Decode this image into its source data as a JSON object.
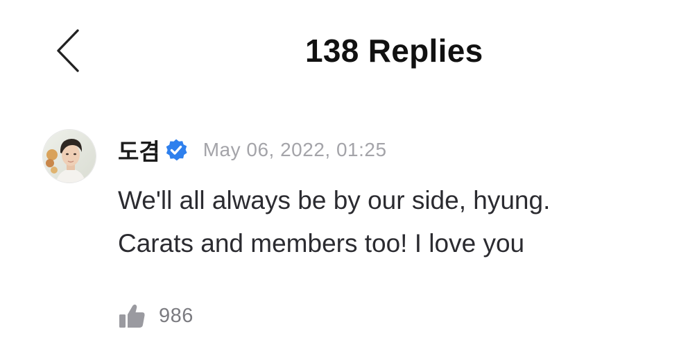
{
  "header": {
    "back_icon": "chevron-left-icon",
    "title": "138 Replies"
  },
  "comment": {
    "avatar_icon": "user-photo-avatar",
    "username": "도겸",
    "verified_icon": "verified-badge-icon",
    "timestamp": "May 06, 2022, 01:25",
    "body_lines": [
      "We'll all always be by our side, hyung.",
      "Carats and members too! I love you"
    ],
    "like_icon": "thumbs-up-icon",
    "like_count": "986"
  },
  "colors": {
    "background": "#ffffff",
    "title": "#111111",
    "text": "#2b2b30",
    "muted": "#a4a4a9",
    "like_count": "#7b7b80",
    "verified": "#2f80ed",
    "thumb": "#9a9aa0"
  }
}
